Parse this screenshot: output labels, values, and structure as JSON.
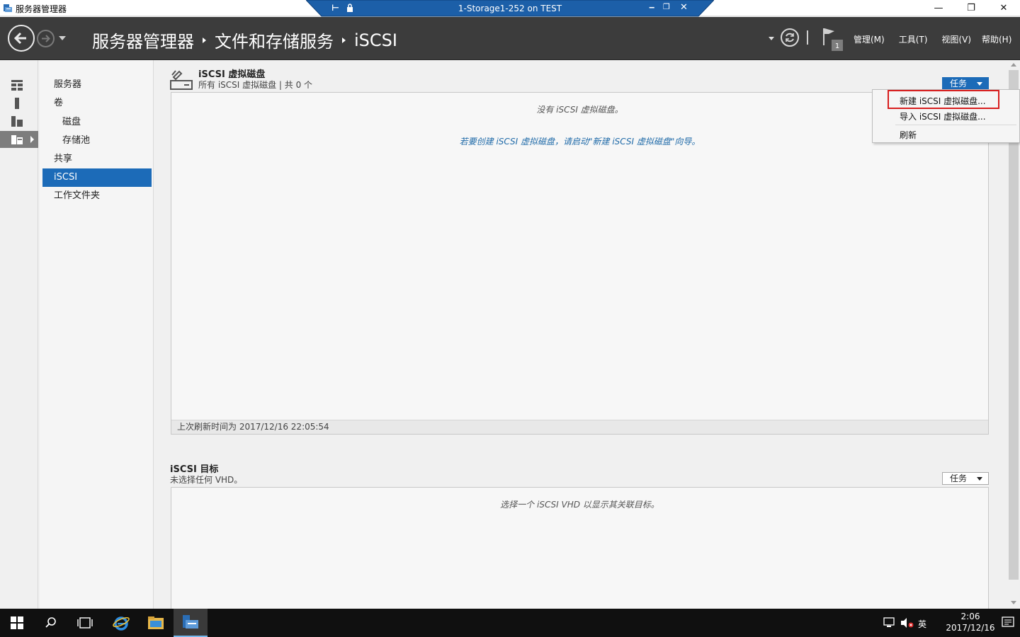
{
  "window": {
    "title": "服务器管理器"
  },
  "rdp": {
    "title": "1-Storage1-252 on TEST"
  },
  "header": {
    "breadcrumb": [
      "服务器管理器",
      "文件和存储服务",
      "iSCSI"
    ],
    "menus": [
      "管理(M)",
      "工具(T)",
      "视图(V)",
      "帮助(H)"
    ],
    "flag_badge": "1"
  },
  "sidebar": {
    "items": [
      {
        "label": "服务器",
        "indent": false
      },
      {
        "label": "卷",
        "indent": false
      },
      {
        "label": "磁盘",
        "indent": true
      },
      {
        "label": "存储池",
        "indent": true
      },
      {
        "label": "共享",
        "indent": false
      },
      {
        "label": "iSCSI",
        "indent": false,
        "active": true
      },
      {
        "label": "工作文件夹",
        "indent": false
      }
    ]
  },
  "vdisk": {
    "title": "iSCSI 虚拟磁盘",
    "subtitle": "所有 iSCSI 虚拟磁盘 | 共 0 个",
    "tasks_label": "任务",
    "empty_msg": "没有 iSCSI 虚拟磁盘。",
    "hint_msg": "若要创建 iSCSI 虚拟磁盘，请启动\"新建 iSCSI 虚拟磁盘\"向导。",
    "last_refresh": "上次刷新时间为 2017/12/16 22:05:54"
  },
  "targets": {
    "title": "iSCSI 目标",
    "subtitle": "未选择任何 VHD。",
    "tasks_label": "任务",
    "empty_msg": "选择一个 iSCSI VHD 以显示其关联目标。"
  },
  "tasks_menu": {
    "items": [
      "新建 iSCSI 虚拟磁盘...",
      "导入 iSCSI 虚拟磁盘...",
      "刷新"
    ]
  },
  "taskbar": {
    "ime": "英",
    "time": "2:06",
    "date": "2017/12/16"
  },
  "colors": {
    "accent": "#1c6bb8",
    "header_bg": "#3c3c3c",
    "highlight_border": "#d81e1e"
  }
}
